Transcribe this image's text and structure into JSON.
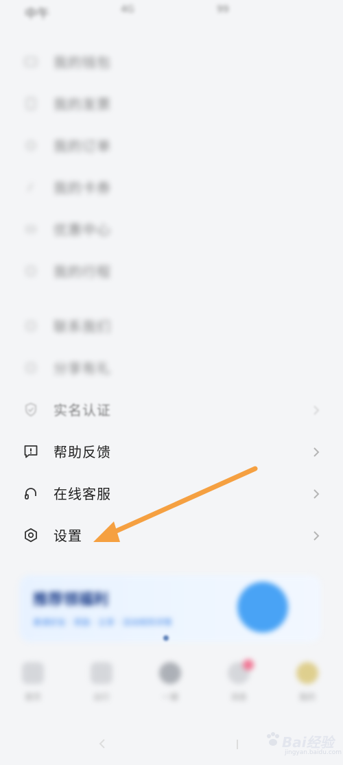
{
  "status_bar": {
    "time": "中午",
    "mid": "4G",
    "right": "99"
  },
  "menu": {
    "items": [
      {
        "label": "我的钱包",
        "icon": "wallet-icon"
      },
      {
        "label": "我的发票",
        "icon": "invoice-icon"
      },
      {
        "label": "我的订单",
        "icon": "order-icon"
      },
      {
        "label": "我的卡券",
        "icon": "coupon-icon"
      },
      {
        "label": "优惠中心",
        "icon": "discount-icon"
      },
      {
        "label": "我的行程",
        "icon": "trip-icon"
      },
      {
        "label": "联系我们",
        "icon": "contact-icon"
      },
      {
        "label": "分享有礼",
        "icon": "gift-icon"
      },
      {
        "label": "实名认证",
        "icon": "shield-check-icon"
      },
      {
        "label": "帮助反馈",
        "icon": "feedback-icon"
      },
      {
        "label": "在线客服",
        "icon": "headset-icon"
      },
      {
        "label": "设置",
        "icon": "gear-icon"
      }
    ]
  },
  "banner": {
    "title": "推荐领福利",
    "subtitle": "邀请好友 · 奖励 · 立享 · 活动规则详情",
    "colors": {
      "accent": "#49a3f5",
      "title": "#1b3d8a"
    }
  },
  "tabbar": {
    "items": [
      {
        "label": "首页"
      },
      {
        "label": "出行"
      },
      {
        "label": "一键"
      },
      {
        "label": "消息"
      },
      {
        "label": "我的"
      }
    ]
  },
  "annotation": {
    "arrow_color": "#f5a041"
  },
  "watermark": {
    "text": "Bai经验",
    "sub": "jingyan.baidu.com"
  }
}
